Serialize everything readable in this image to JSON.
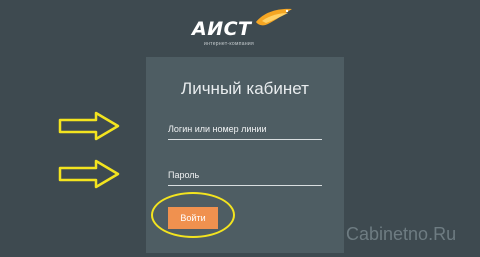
{
  "header": {
    "logo_text": "АИСТ",
    "logo_subtitle": "интернет-компания"
  },
  "login_panel": {
    "title": "Личный кабинет",
    "login_placeholder": "Логин или номер линии",
    "password_placeholder": "Пароль",
    "submit_label": "Войти"
  },
  "watermark": "Cabinetno.Ru",
  "colors": {
    "background": "#3e4a50",
    "panel": "#4e5d63",
    "accent_button": "#f0914f",
    "highlight": "#f3e41f",
    "logo_bird": "#f5a623"
  },
  "annotations": {
    "arrow_icon": "arrow-right-icon",
    "highlight_shape": "ellipse-outline"
  }
}
